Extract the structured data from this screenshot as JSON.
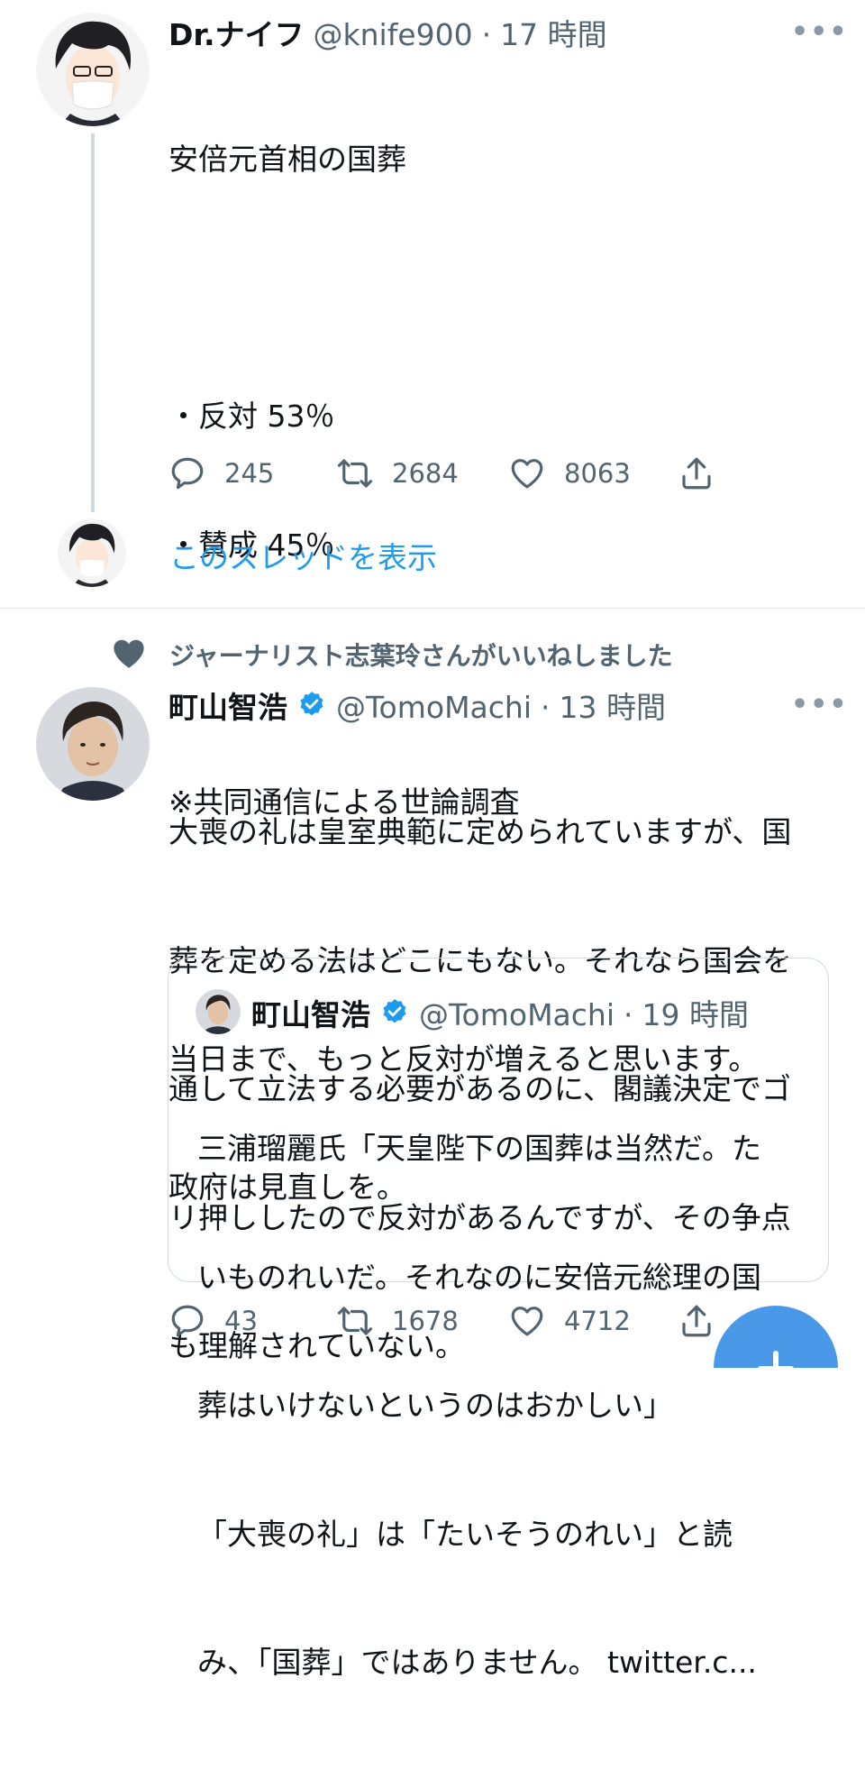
{
  "tweet1": {
    "name": "Dr.ナイフ",
    "handle": "@knife900",
    "separator": "·",
    "time": "17 時間",
    "lines": [
      "安倍元首相の国葬",
      "",
      "・反対 53％",
      "・賛成 45％",
      "",
      "※共同通信による世論調査",
      "",
      "当日まで、もっと反対が増えると思います。",
      "政府は見直しを。"
    ],
    "more": "•••",
    "actions": {
      "reply": "245",
      "retweet": "2684",
      "like": "8063"
    },
    "thread_link": "このスレッドを表示"
  },
  "tweet2": {
    "social_context": "ジャーナリスト志葉玲さんがいいねしました",
    "name": "町山智浩",
    "handle": "@TomoMachi",
    "separator": "·",
    "time": "13 時間",
    "more": "•••",
    "lines": [
      "大喪の礼は皇室典範に定められていますが、国",
      "葬を定める法はどこにもない。それなら国会を",
      "通して立法する必要があるのに、閣議決定でゴ",
      "リ押ししたので反対があるんですが、その争点",
      "も理解されていない。"
    ],
    "quote": {
      "name": "町山智浩",
      "handle": "@TomoMachi",
      "separator": "·",
      "time": "19 時間",
      "lines": [
        "三浦瑠麗氏「天皇陛下の国葬は当然だ。た",
        "いものれいだ。それなのに安倍元総理の国",
        "葬はいけないというのはおかしい」",
        "「大喪の礼」は「たいそうのれい」と読",
        "み、「国葬」ではありません。 twitter.c..."
      ]
    },
    "actions": {
      "reply": "43",
      "retweet": "1678",
      "like": "4712"
    }
  },
  "colors": {
    "accent": "#1d9bf0",
    "text": "#0f1419",
    "secondary": "#536471",
    "divider": "#e3e6ea",
    "fab": "#4a99e9"
  }
}
